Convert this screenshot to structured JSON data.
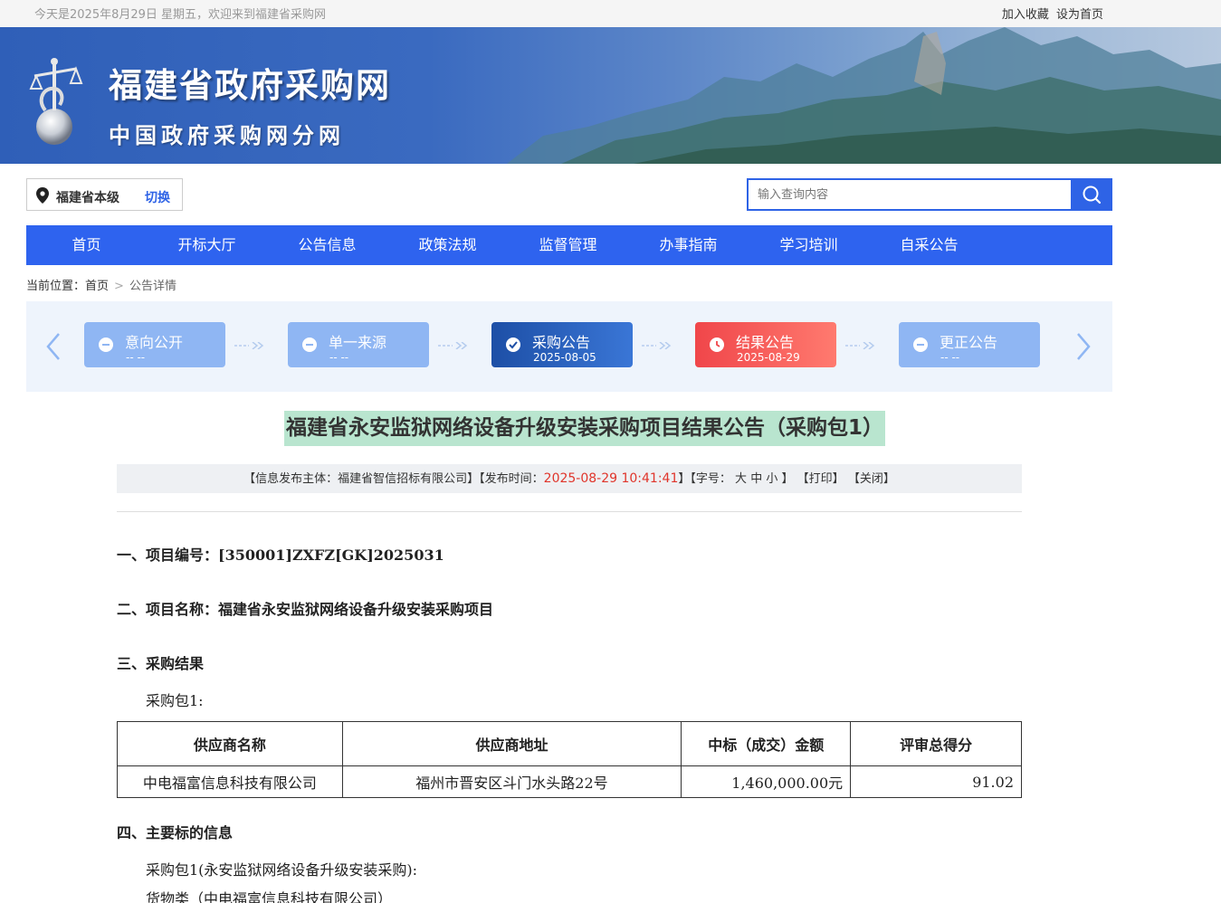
{
  "topbar": {
    "date": "今天是2025年8月29日 星期五，欢迎来到福建省采购网",
    "favorite": "加入收藏",
    "homepage": "设为首页"
  },
  "banner": {
    "title": "福建省政府采购网",
    "subtitle": "中国政府采购网分网"
  },
  "location": {
    "name": "福建省本级",
    "switch": "切换"
  },
  "search": {
    "placeholder": "输入查询内容"
  },
  "nav": [
    "首页",
    "开标大厅",
    "公告信息",
    "政策法规",
    "监督管理",
    "办事指南",
    "学习培训",
    "自采公告"
  ],
  "breadcrumb": {
    "prefix": "当前位置：",
    "home": "首页",
    "current": "公告详情"
  },
  "steps": [
    {
      "label": "意向公开",
      "date": "-- --"
    },
    {
      "label": "单一来源",
      "date": "-- --"
    },
    {
      "label": "采购公告",
      "date": "2025-08-05"
    },
    {
      "label": "结果公告",
      "date": "2025-08-29"
    },
    {
      "label": "更正公告",
      "date": "-- --"
    }
  ],
  "article": {
    "title": "福建省永安监狱网络设备升级安装采购项目结果公告（采购包1）",
    "meta": {
      "publisher": "【信息发布主体：福建省智信招标有限公司】",
      "time_label": "【发布时间：",
      "time": "2025-08-29 10:41:41",
      "time_end": "】",
      "font_label": "【字号：",
      "font_l": "大",
      "font_m": "中",
      "font_s": "小",
      "font_end": "】",
      "print": "【打印】",
      "close": "【关闭】"
    },
    "sec1": "一、项目编号：[350001]ZXFZ[GK]2025031",
    "sec2": "二、项目名称：福建省永安监狱网络设备升级安装采购项目",
    "sec3": "三、采购结果",
    "package": "采购包1:",
    "table": {
      "headers": [
        "供应商名称",
        "供应商地址",
        "中标（成交）金额",
        "评审总得分"
      ],
      "row": [
        "中电福富信息科技有限公司",
        "福州市晋安区斗门水头路22号",
        "1,460,000.00元",
        "91.02"
      ]
    },
    "sec4": "四、主要标的信息",
    "sec4_p1": "采购包1(永安监狱网络设备升级安装采购):",
    "sec4_p2": "货物类（中电福富信息科技有限公司）"
  }
}
